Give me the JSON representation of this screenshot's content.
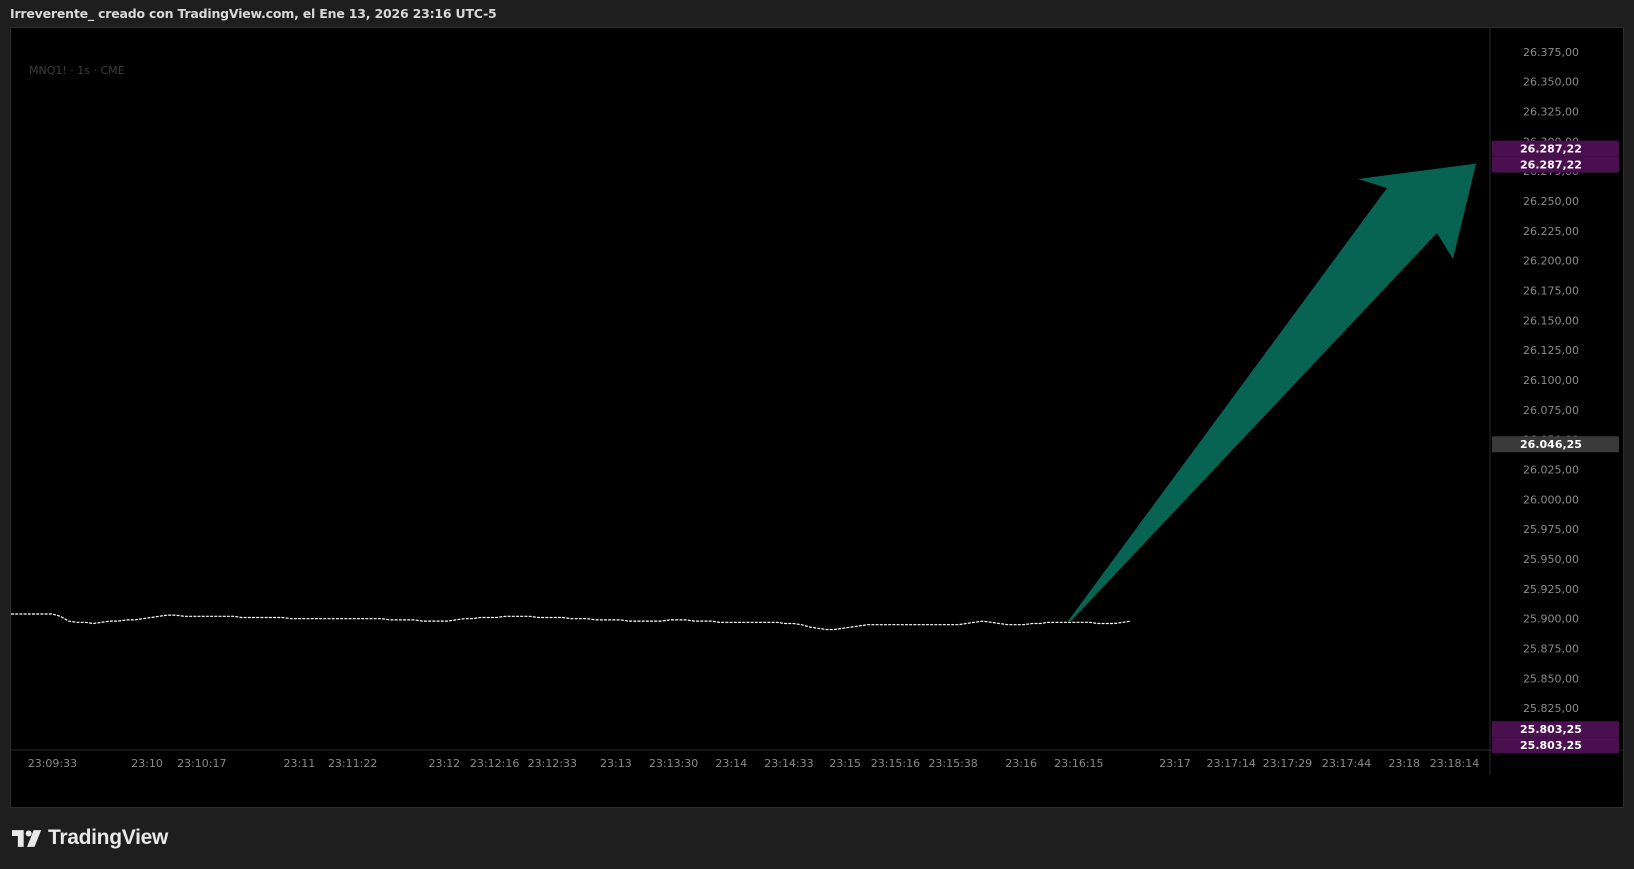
{
  "header": {
    "title": "Irreverente_ creado con TradingView.com, el Ene 13, 2026 23:16 UTC-5"
  },
  "symbol": {
    "label": "MNQ1! · 1s · CME"
  },
  "footer": {
    "brand": "TradingView"
  },
  "colors": {
    "background": "#000000",
    "frame": "#1e1e1e",
    "price_line": "#ffffff",
    "arrow": "#076452",
    "target_badge": "#4a0f4f",
    "current_badge": "#3a3a3a",
    "axis_text": "#8a8a8a"
  },
  "icons": {
    "logo": "tradingview-logo-icon"
  },
  "chart_data": {
    "type": "line",
    "title": "",
    "xlabel": "",
    "ylabel": "",
    "ylim": [
      25790,
      26395
    ],
    "grid": false,
    "y_ticks": [
      "26.375,00",
      "26.350,00",
      "26.325,00",
      "26.300,00",
      "26.275,00",
      "26.250,00",
      "26.225,00",
      "26.200,00",
      "26.175,00",
      "26.150,00",
      "26.125,00",
      "26.100,00",
      "26.075,00",
      "26.050,00",
      "26.025,00",
      "26.000,00",
      "25.975,00",
      "25.950,00",
      "25.925,00",
      "25.900,00",
      "25.875,00",
      "25.850,00",
      "25.825,00"
    ],
    "y_tick_values": [
      26375,
      26350,
      26325,
      26300,
      26275,
      26250,
      26225,
      26200,
      26175,
      26150,
      26125,
      26100,
      26075,
      26050,
      26025,
      26000,
      25975,
      25950,
      25925,
      25900,
      25875,
      25850,
      25825
    ],
    "x_ticks": [
      "23:09:33",
      "23:10",
      "23:10:17",
      "23:11",
      "23:11:22",
      "23:12",
      "23:12:16",
      "23:12:33",
      "23:13",
      "23:13:30",
      "23:14",
      "23:14:33",
      "23:15",
      "23:15:16",
      "23:15:38",
      "23:16",
      "23:16:15",
      "23:17",
      "23:17:14",
      "23:17:29",
      "23:17:44",
      "23:18",
      "23:18:14"
    ],
    "x_tick_positions": [
      0.028,
      0.092,
      0.129,
      0.195,
      0.231,
      0.293,
      0.327,
      0.366,
      0.409,
      0.448,
      0.487,
      0.526,
      0.564,
      0.598,
      0.637,
      0.683,
      0.722,
      0.787,
      0.825,
      0.863,
      0.903,
      0.942,
      0.976
    ],
    "series": [
      {
        "values": [
          25904,
          25904,
          25904,
          25904,
          25904,
          25904,
          25902,
          25898,
          25897,
          25897,
          25896,
          25897,
          25898,
          25898,
          25899,
          25899,
          25900,
          25901,
          25902,
          25903,
          25903,
          25902,
          25902,
          25902,
          25902,
          25902,
          25902,
          25902,
          25901,
          25901,
          25901,
          25901,
          25901,
          25901,
          25900,
          25900,
          25900,
          25900,
          25900,
          25900,
          25900,
          25900,
          25900,
          25900,
          25900,
          25900,
          25899,
          25899,
          25899,
          25899,
          25898,
          25898,
          25898,
          25898,
          25899,
          25900,
          25900,
          25901,
          25901,
          25901,
          25902,
          25902,
          25902,
          25902,
          25901,
          25901,
          25901,
          25901,
          25900,
          25900,
          25900,
          25899,
          25899,
          25899,
          25899,
          25898,
          25898,
          25898,
          25898,
          25898,
          25899,
          25899,
          25899,
          25898,
          25898,
          25898,
          25897,
          25897,
          25897,
          25897,
          25897,
          25897,
          25897,
          25897,
          25896,
          25896,
          25895,
          25893,
          25892,
          25891,
          25891,
          25892,
          25893,
          25894,
          25895,
          25895,
          25895,
          25895,
          25895,
          25895,
          25895,
          25895,
          25895,
          25895,
          25895,
          25895,
          25896,
          25897,
          25898,
          25897,
          25896,
          25895,
          25895,
          25895,
          25896,
          25896,
          25897,
          25897,
          25897,
          25897,
          25897,
          25897,
          25896,
          25896,
          25896,
          25897,
          25898
        ]
      }
    ],
    "price_labels": [
      {
        "text": "26.287,22",
        "value": 26287.22,
        "kind": "target"
      },
      {
        "text": "26.287,22",
        "value": 26287.22,
        "kind": "target"
      },
      {
        "text": "26.046,25",
        "value": 26046.25,
        "kind": "current"
      },
      {
        "text": "25.803,25",
        "value": 25803.25,
        "kind": "target"
      },
      {
        "text": "25.803,25",
        "value": 25803.25,
        "kind": "target"
      }
    ],
    "annotation": {
      "type": "arrow",
      "from_value": 25898,
      "to_value": 26287.22,
      "direction": "up-right"
    }
  }
}
